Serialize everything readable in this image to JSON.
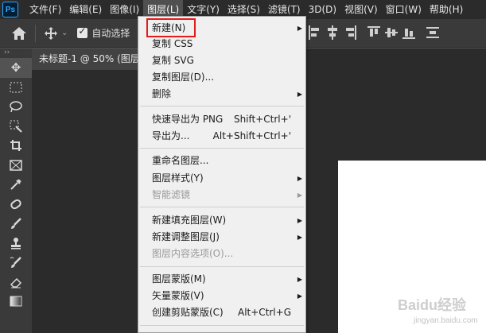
{
  "app": {
    "logo_text": "Ps"
  },
  "menubar": {
    "items": [
      "文件(F)",
      "编辑(E)",
      "图像(I)",
      "图层(L)",
      "文字(Y)",
      "选择(S)",
      "滤镜(T)",
      "3D(D)",
      "视图(V)",
      "窗口(W)",
      "帮助(H)"
    ],
    "active_index": 3
  },
  "options": {
    "auto_select_label": "自动选择",
    "auto_select_checked": true
  },
  "document": {
    "tab_title": "未标题-1 @ 50% (图层"
  },
  "toolbar": {
    "collapse_label": "››",
    "tools": [
      "move-tool",
      "marquee-tool",
      "lasso-tool",
      "quick-select-tool",
      "crop-tool",
      "frame-tool",
      "eyedropper-tool",
      "healing-brush-tool",
      "brush-tool",
      "clone-stamp-tool",
      "history-brush-tool",
      "eraser-tool",
      "gradient-tool"
    ]
  },
  "layer_menu": {
    "items": [
      {
        "label": "新建(N)",
        "shortcut": "",
        "submenu": true,
        "disabled": false
      },
      {
        "label": "复制 CSS",
        "shortcut": "",
        "submenu": false,
        "disabled": false
      },
      {
        "label": "复制 SVG",
        "shortcut": "",
        "submenu": false,
        "disabled": false
      },
      {
        "label": "复制图层(D)...",
        "shortcut": "",
        "submenu": false,
        "disabled": false
      },
      {
        "label": "删除",
        "shortcut": "",
        "submenu": true,
        "disabled": false
      },
      {
        "label": "快速导出为 PNG",
        "shortcut": "Shift+Ctrl+'",
        "submenu": false,
        "disabled": false
      },
      {
        "label": "导出为...",
        "shortcut": "Alt+Shift+Ctrl+'",
        "submenu": false,
        "disabled": false
      },
      {
        "label": "重命名图层...",
        "shortcut": "",
        "submenu": false,
        "disabled": false
      },
      {
        "label": "图层样式(Y)",
        "shortcut": "",
        "submenu": true,
        "disabled": false
      },
      {
        "label": "智能滤镜",
        "shortcut": "",
        "submenu": true,
        "disabled": true
      },
      {
        "label": "新建填充图层(W)",
        "shortcut": "",
        "submenu": true,
        "disabled": false
      },
      {
        "label": "新建调整图层(J)",
        "shortcut": "",
        "submenu": true,
        "disabled": false
      },
      {
        "label": "图层内容选项(O)...",
        "shortcut": "",
        "submenu": false,
        "disabled": true
      },
      {
        "label": "图层蒙版(M)",
        "shortcut": "",
        "submenu": true,
        "disabled": false
      },
      {
        "label": "矢量蒙版(V)",
        "shortcut": "",
        "submenu": true,
        "disabled": false
      },
      {
        "label": "创建剪贴蒙版(C)",
        "shortcut": "Alt+Ctrl+G",
        "submenu": false,
        "disabled": false
      }
    ],
    "highlighted_index": 0
  },
  "watermark": {
    "text": "Baidu经验",
    "sub": "jingyan.baidu.com"
  },
  "colors": {
    "menubar_bg": "#2b2b2b",
    "menu_bg": "#f0f0f0",
    "highlight_border": "#e21b1b"
  }
}
